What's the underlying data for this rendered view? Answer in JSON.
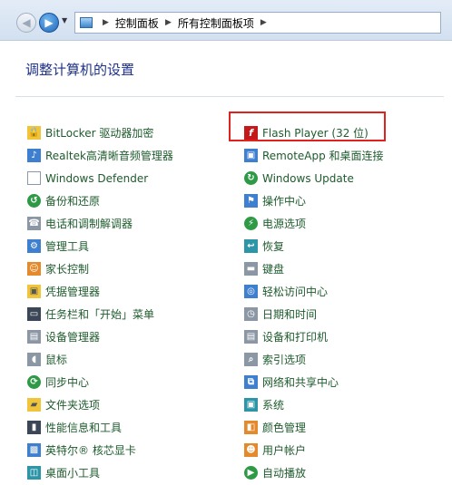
{
  "breadcrumb": [
    "控制面板",
    "所有控制面板项"
  ],
  "page_title": "调整计算机的设置",
  "left_items": [
    {
      "label": "BitLocker 驱动器加密",
      "icon": "bitlocker-icon",
      "cls": "yellow",
      "glyph": "🔒"
    },
    {
      "label": "Realtek高清晰音频管理器",
      "icon": "audio-manager-icon",
      "cls": "blue",
      "glyph": "♪"
    },
    {
      "label": "Windows Defender",
      "icon": "defender-icon",
      "cls": "doc",
      "glyph": ""
    },
    {
      "label": "备份和还原",
      "icon": "backup-icon",
      "cls": "green",
      "glyph": "↺"
    },
    {
      "label": "电话和调制解调器",
      "icon": "phone-modem-icon",
      "cls": "gray",
      "glyph": "☎"
    },
    {
      "label": "管理工具",
      "icon": "admin-tools-icon",
      "cls": "blue",
      "glyph": "⚙"
    },
    {
      "label": "家长控制",
      "icon": "parental-control-icon",
      "cls": "orange",
      "glyph": "☺"
    },
    {
      "label": "凭据管理器",
      "icon": "credential-manager-icon",
      "cls": "yellow",
      "glyph": "▣"
    },
    {
      "label": "任务栏和「开始」菜单",
      "icon": "taskbar-icon",
      "cls": "dark",
      "glyph": "▭"
    },
    {
      "label": "设备管理器",
      "icon": "device-manager-icon",
      "cls": "gray",
      "glyph": "▤"
    },
    {
      "label": "鼠标",
      "icon": "mouse-icon",
      "cls": "gray",
      "glyph": "◖"
    },
    {
      "label": "同步中心",
      "icon": "sync-center-icon",
      "cls": "green",
      "glyph": "⟳"
    },
    {
      "label": "文件夹选项",
      "icon": "folder-options-icon",
      "cls": "yellow",
      "glyph": "▰"
    },
    {
      "label": "性能信息和工具",
      "icon": "performance-icon",
      "cls": "dark",
      "glyph": "▮"
    },
    {
      "label": "英特尔® 核芯显卡",
      "icon": "intel-graphics-icon",
      "cls": "blue",
      "glyph": "▩"
    },
    {
      "label": "桌面小工具",
      "icon": "gadgets-icon",
      "cls": "teal",
      "glyph": "◫"
    }
  ],
  "right_items": [
    {
      "label": "Flash Player (32 位)",
      "icon": "flash-player-icon",
      "cls": "flash",
      "glyph": "f"
    },
    {
      "label": "RemoteApp 和桌面连接",
      "icon": "remoteapp-icon",
      "cls": "blue",
      "glyph": "▣"
    },
    {
      "label": "Windows Update",
      "icon": "windows-update-icon",
      "cls": "green",
      "glyph": "↻"
    },
    {
      "label": "操作中心",
      "icon": "action-center-icon",
      "cls": "blue",
      "glyph": "⚑"
    },
    {
      "label": "电源选项",
      "icon": "power-options-icon",
      "cls": "green",
      "glyph": "⚡"
    },
    {
      "label": "恢复",
      "icon": "recovery-icon",
      "cls": "teal",
      "glyph": "↩"
    },
    {
      "label": "键盘",
      "icon": "keyboard-icon",
      "cls": "gray",
      "glyph": "▬"
    },
    {
      "label": "轻松访问中心",
      "icon": "ease-of-access-icon",
      "cls": "blue",
      "glyph": "◎"
    },
    {
      "label": "日期和时间",
      "icon": "date-time-icon",
      "cls": "gray",
      "glyph": "◷"
    },
    {
      "label": "设备和打印机",
      "icon": "printer-icon",
      "cls": "gray",
      "glyph": "▤"
    },
    {
      "label": "索引选项",
      "icon": "indexing-icon",
      "cls": "gray",
      "glyph": "⌕"
    },
    {
      "label": "网络和共享中心",
      "icon": "network-icon",
      "cls": "blue",
      "glyph": "⧉"
    },
    {
      "label": "系统",
      "icon": "system-icon",
      "cls": "teal",
      "glyph": "▣"
    },
    {
      "label": "颜色管理",
      "icon": "color-management-icon",
      "cls": "orange",
      "glyph": "◧"
    },
    {
      "label": "用户帐户",
      "icon": "user-accounts-icon",
      "cls": "orange",
      "glyph": "☻"
    },
    {
      "label": "自动播放",
      "icon": "autoplay-icon",
      "cls": "green",
      "glyph": "▶"
    }
  ],
  "colors": {
    "link": "#1e5b2d",
    "title": "#1e3287",
    "highlight": "#e0221f"
  }
}
